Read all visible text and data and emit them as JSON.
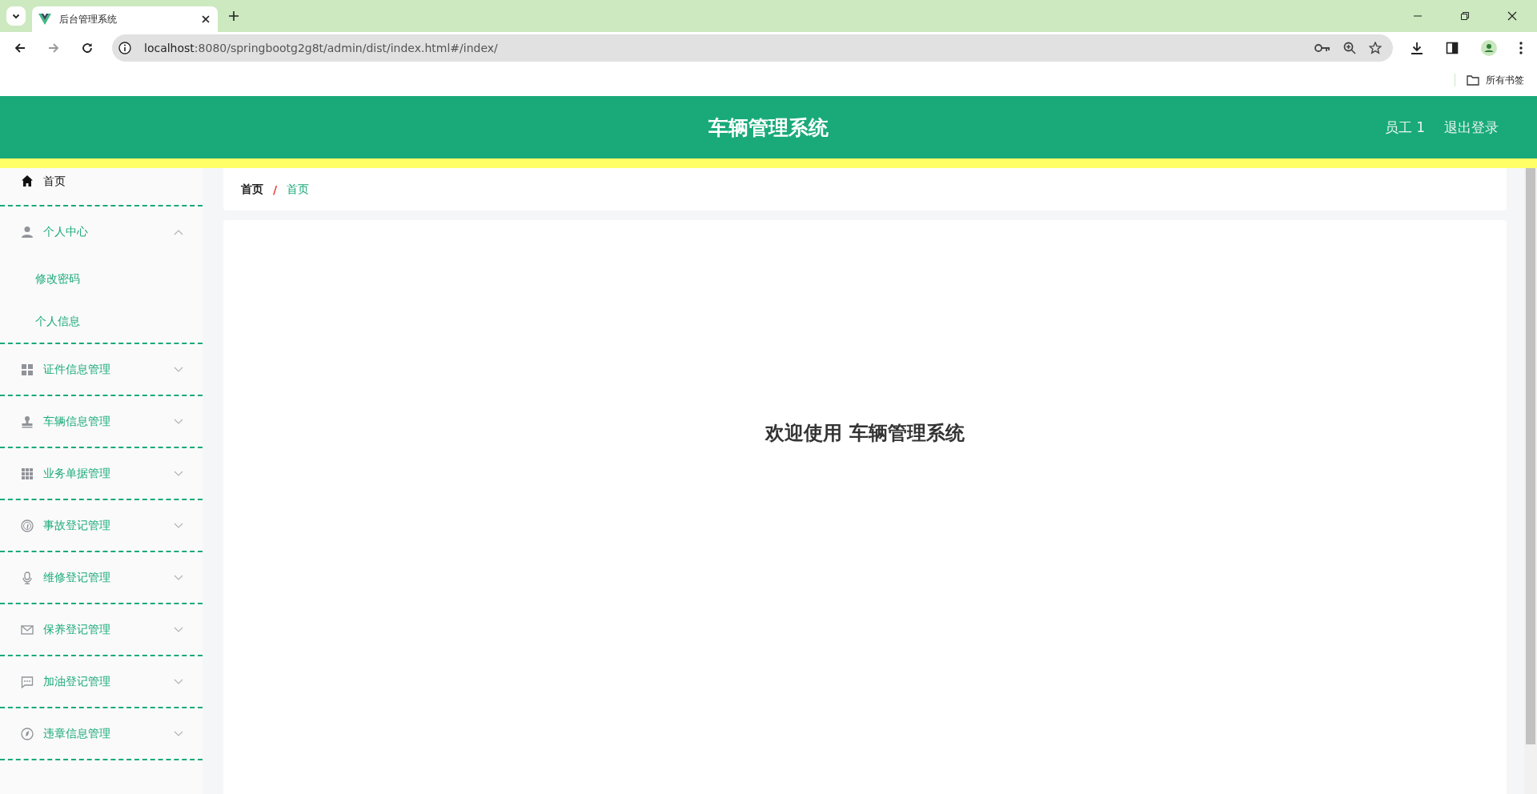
{
  "browser": {
    "tab_title": "后台管理系统",
    "address_host": "localhost",
    "address_path": ":8080/springbootg2g8t/admin/dist/index.html#/index/",
    "bookmarks_label": "所有书签"
  },
  "header": {
    "title": "车辆管理系统",
    "user": "员工 1",
    "logout": "退出登录"
  },
  "sidebar": {
    "items": [
      {
        "kind": "link",
        "label": "首页",
        "selected": true
      },
      {
        "kind": "submenu",
        "label": "个人中心",
        "selected": false,
        "expanded": true,
        "children": [
          {
            "label": "修改密码"
          },
          {
            "label": "个人信息"
          }
        ]
      },
      {
        "kind": "submenu",
        "label": "证件信息管理",
        "selected": false,
        "expanded": false
      },
      {
        "kind": "submenu",
        "label": "车辆信息管理",
        "selected": false,
        "expanded": false
      },
      {
        "kind": "submenu",
        "label": "业务单据管理",
        "selected": false,
        "expanded": false
      },
      {
        "kind": "submenu",
        "label": "事故登记管理",
        "selected": false,
        "expanded": false
      },
      {
        "kind": "submenu",
        "label": "维修登记管理",
        "selected": false,
        "expanded": false
      },
      {
        "kind": "submenu",
        "label": "保养登记管理",
        "selected": false,
        "expanded": false
      },
      {
        "kind": "submenu",
        "label": "加油登记管理",
        "selected": false,
        "expanded": false
      },
      {
        "kind": "submenu",
        "label": "违章信息管理",
        "selected": false,
        "expanded": false
      }
    ]
  },
  "breadcrumb": [
    "首页",
    "首页"
  ],
  "breadcrumb_separator": "/",
  "welcome": "欢迎使用 车辆管理系统"
}
